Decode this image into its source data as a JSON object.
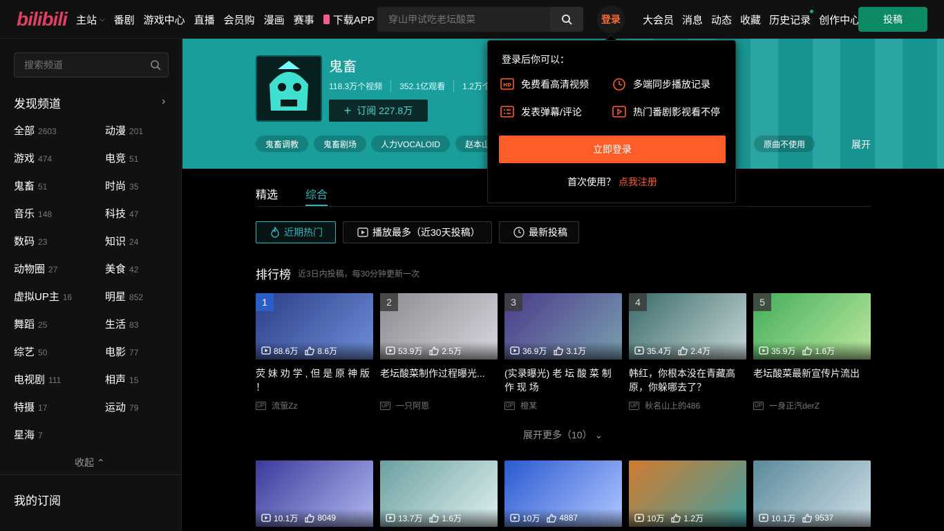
{
  "header": {
    "logo": "bilibili",
    "nav": [
      "主站",
      "番剧",
      "游戏中心",
      "直播",
      "会员购",
      "漫画",
      "赛事",
      "下载APP"
    ],
    "search_placeholder": "穿山甲试吃老坛酸菜",
    "login": "登录",
    "right_nav": [
      "大会员",
      "消息",
      "动态",
      "收藏",
      "历史记录",
      "创作中心"
    ],
    "upload": "投稿"
  },
  "sidebar": {
    "search_placeholder": "搜索频道",
    "discover": "发现频道",
    "categories": [
      {
        "name": "全部",
        "count": "2603"
      },
      {
        "name": "动漫",
        "count": "201"
      },
      {
        "name": "游戏",
        "count": "474"
      },
      {
        "name": "电竞",
        "count": "51"
      },
      {
        "name": "鬼畜",
        "count": "51"
      },
      {
        "name": "时尚",
        "count": "35"
      },
      {
        "name": "音乐",
        "count": "148"
      },
      {
        "name": "科技",
        "count": "47"
      },
      {
        "name": "数码",
        "count": "23"
      },
      {
        "name": "知识",
        "count": "24"
      },
      {
        "name": "动物圈",
        "count": "27"
      },
      {
        "name": "美食",
        "count": "42"
      },
      {
        "name": "虚拟UP主",
        "count": "16"
      },
      {
        "name": "明星",
        "count": "852"
      },
      {
        "name": "舞蹈",
        "count": "25"
      },
      {
        "name": "生活",
        "count": "83"
      },
      {
        "name": "综艺",
        "count": "50"
      },
      {
        "name": "电影",
        "count": "77"
      },
      {
        "name": "电视剧",
        "count": "111"
      },
      {
        "name": "相声",
        "count": "15"
      },
      {
        "name": "特摄",
        "count": "17"
      },
      {
        "name": "运动",
        "count": "79"
      },
      {
        "name": "星海",
        "count": "7"
      }
    ],
    "collapse": "收起",
    "my_sub": "我的订阅"
  },
  "channel": {
    "name": "鬼畜",
    "videos": "118.3万个视频",
    "views": "352.1亿观看",
    "extra": "1.2万个",
    "subscribe": "订阅 227.8万",
    "tags": [
      "鬼畜调教",
      "鬼畜剧场",
      "人力VOCALOID",
      "赵本山",
      "原曲不使用"
    ],
    "expand": "展开"
  },
  "tabs": [
    "精选",
    "综合"
  ],
  "filters": [
    "近期热门",
    "播放最多（近30天投稿）",
    "最新投稿"
  ],
  "ranking": {
    "title": "排行榜",
    "subtitle": "近3日内投稿，每30分钟更新一次",
    "more": "展开更多（10）"
  },
  "videos": [
    {
      "rank": "1",
      "views": "88.6万",
      "likes": "8.6万",
      "title": "荧 妹 劝 学 , 但 是 原 神 版 ！",
      "up": "流萤Zz"
    },
    {
      "rank": "2",
      "views": "53.9万",
      "likes": "2.5万",
      "title": "老坛酸菜制作过程曝光...",
      "up": "一只阿恩"
    },
    {
      "rank": "3",
      "views": "36.9万",
      "likes": "3.1万",
      "title": "(实录曝光) 老 坛 酸 菜 制 作 现 场",
      "up": "橙某"
    },
    {
      "rank": "4",
      "views": "35.4万",
      "likes": "2.4万",
      "title": "韩红，你根本没在青藏高原，你躲哪去了？",
      "up": "秋名山上的486"
    },
    {
      "rank": "5",
      "views": "35.9万",
      "likes": "1.6万",
      "title": "老坛酸菜最新宣传片流出",
      "up": "一身正汽derZ"
    }
  ],
  "videos2": [
    {
      "views": "10.1万",
      "likes": "8049"
    },
    {
      "views": "13.7万",
      "likes": "1.6万"
    },
    {
      "views": "10万",
      "likes": "4887"
    },
    {
      "views": "10万",
      "likes": "1.2万"
    },
    {
      "views": "10.1万",
      "likes": "9537"
    }
  ],
  "popup": {
    "title": "登录后你可以：",
    "perks": [
      "免费看高清视频",
      "多端同步播放记录",
      "发表弹幕/评论",
      "热门番剧影视看不停"
    ],
    "login_button": "立即登录",
    "reg_prefix": "首次使用？",
    "reg_link": "点我注册"
  },
  "colors": {
    "accent": "#35b3b8",
    "brand": "#ff5c2a",
    "banner": "#1a9e9c"
  }
}
